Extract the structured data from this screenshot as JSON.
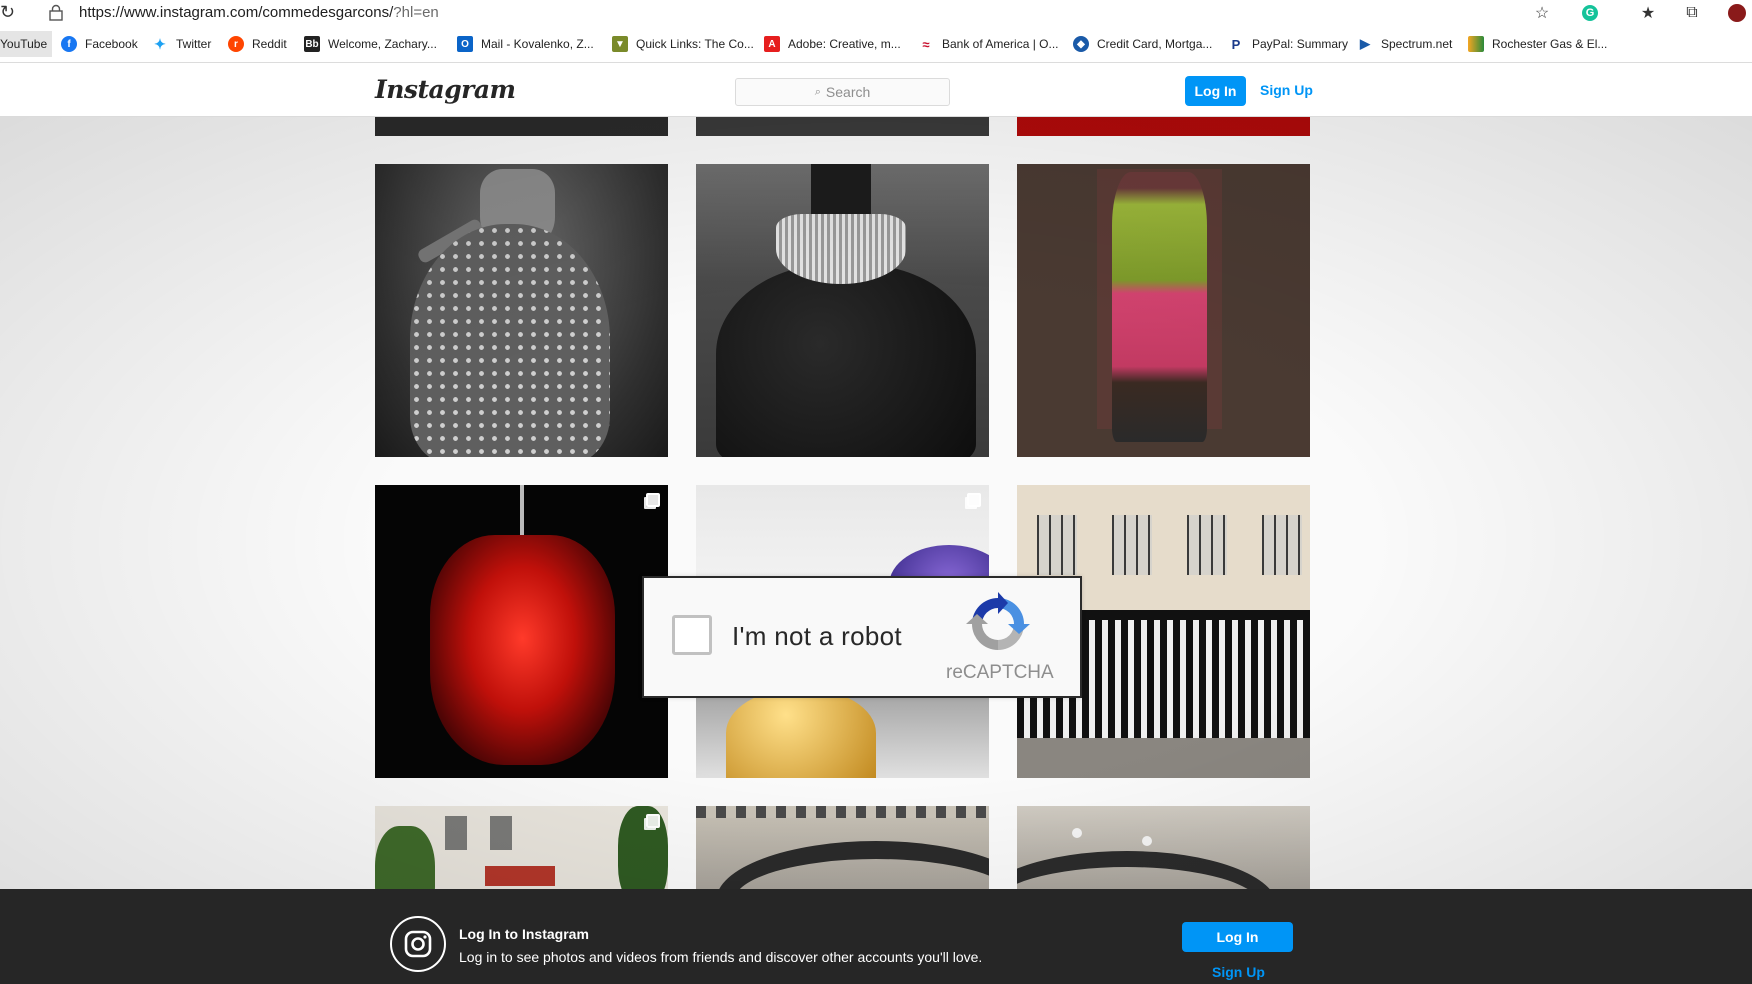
{
  "browser": {
    "url_main": "https://www.instagram.com/commedesgarcons/",
    "url_query": "?hl=en",
    "bookmarks": [
      {
        "label": "YouTube",
        "icon": "youtube-icon"
      },
      {
        "label": "Facebook",
        "icon": "facebook-icon"
      },
      {
        "label": "Twitter",
        "icon": "twitter-icon"
      },
      {
        "label": "Reddit",
        "icon": "reddit-icon"
      },
      {
        "label": "Welcome, Zachary...",
        "icon": "blackboard-icon"
      },
      {
        "label": "Mail - Kovalenko, Z...",
        "icon": "outlook-icon"
      },
      {
        "label": "Quick Links: The Co...",
        "icon": "shield-icon"
      },
      {
        "label": "Adobe: Creative, m...",
        "icon": "adobe-icon"
      },
      {
        "label": "Bank of America | O...",
        "icon": "bank-of-america-icon"
      },
      {
        "label": "Credit Card, Mortga...",
        "icon": "chase-icon"
      },
      {
        "label": "PayPal: Summary",
        "icon": "paypal-icon"
      },
      {
        "label": "Spectrum.net",
        "icon": "spectrum-icon"
      },
      {
        "label": "Rochester Gas & El...",
        "icon": "rge-icon"
      }
    ]
  },
  "header": {
    "logo": "Instagram",
    "search_placeholder": "Search",
    "login": "Log In",
    "signup": "Sign Up"
  },
  "recaptcha": {
    "label": "I'm not a robot",
    "brand": "reCAPTCHA"
  },
  "bottom_bar": {
    "title": "Log In to Instagram",
    "text": "Log in to see photos and videos from friends and discover other accounts you'll love.",
    "login": "Log In",
    "signup": "Sign Up"
  },
  "colors": {
    "accent": "#0095f6",
    "bottom_bar": "#262626"
  }
}
